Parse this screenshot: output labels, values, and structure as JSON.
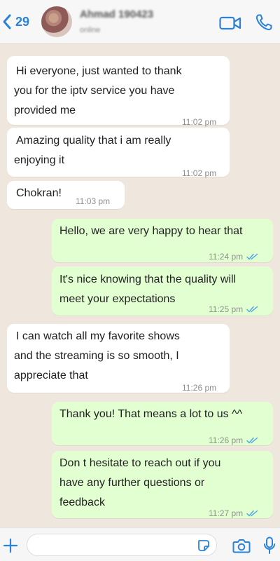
{
  "header": {
    "back_count": "29",
    "contact_name": "Ahmad 190423",
    "contact_status": "online"
  },
  "colors": {
    "accent": "#2b82d9",
    "incoming_bubble": "#ffffff",
    "outgoing_bubble": "#e2ffd1",
    "chat_background": "#efe7dd",
    "read_ticks": "#4aa3e6"
  },
  "messages": [
    {
      "direction": "in",
      "lines": [
        "Hi everyone, just wanted to thank",
        "you for the iptv service you have",
        "provided me"
      ],
      "time": "11:02 pm"
    },
    {
      "direction": "in",
      "lines": [
        "Amazing quality that i am really",
        "enjoying it"
      ],
      "time": "11:02 pm"
    },
    {
      "direction": "in",
      "lines": [
        "Chokran!"
      ],
      "time": "11:03 pm"
    },
    {
      "direction": "out",
      "lines": [
        "Hello, we are very happy to hear that"
      ],
      "time": "11:24 pm",
      "status": "read"
    },
    {
      "direction": "out",
      "lines": [
        "It's nice knowing that the quality will",
        "meet your expectations"
      ],
      "time": "11:25 pm",
      "status": "read"
    },
    {
      "direction": "in",
      "lines": [
        "I can watch all my favorite shows",
        "and the streaming is so smooth, I",
        "appreciate that"
      ],
      "time": "11:26 pm"
    },
    {
      "direction": "out",
      "lines": [
        "Thank you! That means a lot to us ^^"
      ],
      "time": "11:26 pm",
      "status": "read"
    },
    {
      "direction": "out",
      "lines": [
        "Don t hesitate to reach out if you",
        "have any further questions or",
        "feedback"
      ],
      "time": "11:27 pm",
      "status": "read"
    }
  ],
  "input": {
    "value": "",
    "placeholder": ""
  },
  "icons": {
    "back": "chevron-left-icon",
    "video": "video-camera-icon",
    "call": "phone-icon",
    "attach": "plus-icon",
    "sticker": "sticker-icon",
    "camera": "camera-icon",
    "mic": "microphone-icon"
  }
}
